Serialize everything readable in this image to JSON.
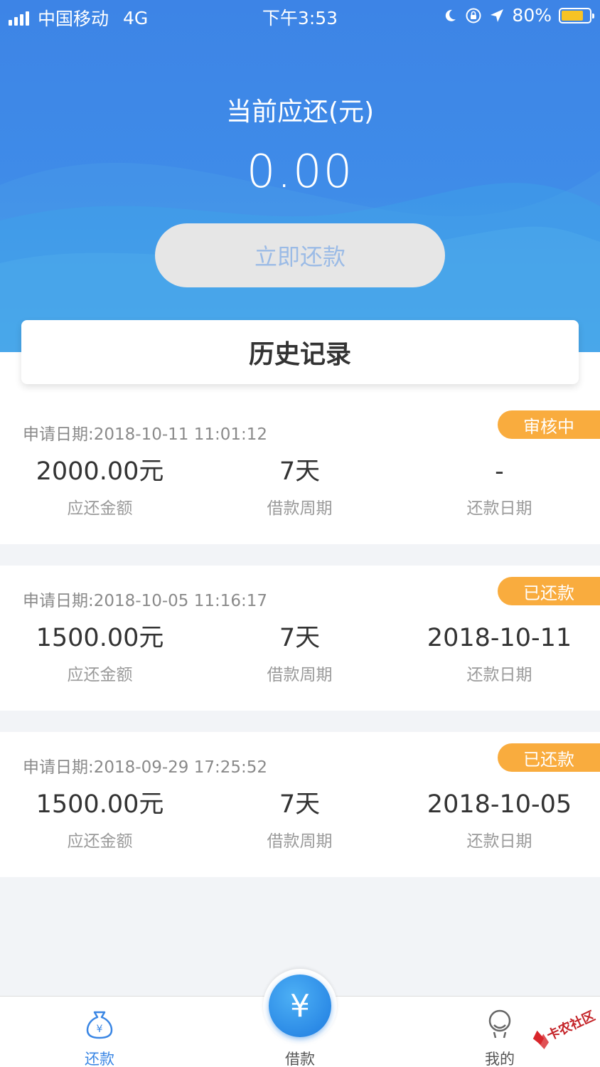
{
  "status_bar": {
    "carrier": "中国移动",
    "network": "4G",
    "time": "下午3:53",
    "battery": "80%",
    "battery_level": 0.8
  },
  "header": {
    "due_label": "当前应还(元)",
    "due_amount": "0.00",
    "repay_button": "立即还款"
  },
  "history_title": "历史记录",
  "records": [
    {
      "date": "申请日期:2018-10-11 11:01:12",
      "status": "审核中",
      "amount": "2000.00元",
      "amount_label": "应还金额",
      "period": "7天",
      "period_label": "借款周期",
      "repay_date": "-",
      "repay_date_label": "还款日期"
    },
    {
      "date": "申请日期:2018-10-05 11:16:17",
      "status": "已还款",
      "amount": "1500.00元",
      "amount_label": "应还金额",
      "period": "7天",
      "period_label": "借款周期",
      "repay_date": "2018-10-11",
      "repay_date_label": "还款日期"
    },
    {
      "date": "申请日期:2018-09-29 17:25:52",
      "status": "已还款",
      "amount": "1500.00元",
      "amount_label": "应还金额",
      "period": "7天",
      "period_label": "借款周期",
      "repay_date": "2018-10-05",
      "repay_date_label": "还款日期"
    }
  ],
  "tabbar": {
    "repay": "还款",
    "borrow": "借款",
    "mine": "我的",
    "borrow_symbol": "¥",
    "active_color": "#3a86e4",
    "inactive_color": "#555555"
  },
  "watermark_text": "卡农社区",
  "colors": {
    "primary": "#3d84e6",
    "badge": "#f9ac3e"
  }
}
